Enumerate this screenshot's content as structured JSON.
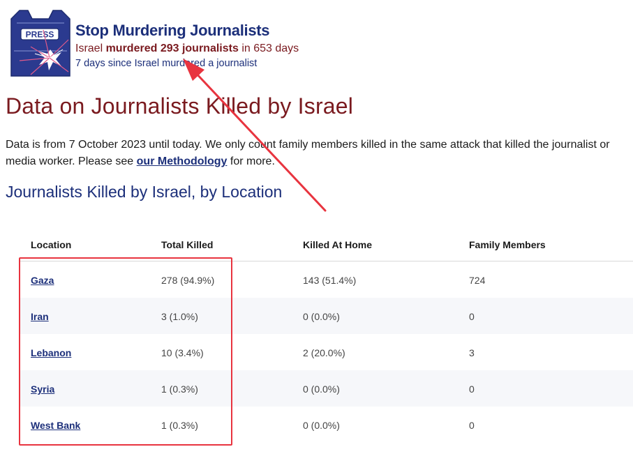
{
  "header": {
    "logo_text": "PRESS",
    "title": "Stop Murdering Journalists",
    "subtitle_prefix": "Israel ",
    "subtitle_bold": "murdered 293 journalists",
    "subtitle_suffix": " in 653 days",
    "days_since": "7 days since Israel murdered a journalist"
  },
  "main": {
    "title": "Data on Journalists Killed by Israel",
    "intro_before_link": "Data is from 7 October 2023 until today. We only count family members killed in the same attack that killed the journalist or media worker. Please see ",
    "intro_link": "our Methodology",
    "intro_after_link": " for more.",
    "section_title": "Journalists Killed by Israel, by Location"
  },
  "table": {
    "headers": [
      "Location",
      "Total Killed",
      "Killed At Home",
      "Family Members"
    ],
    "rows": [
      {
        "location": "Gaza",
        "total": "278 (94.9%)",
        "home": "143 (51.4%)",
        "family": "724"
      },
      {
        "location": "Iran",
        "total": "3 (1.0%)",
        "home": "0 (0.0%)",
        "family": "0"
      },
      {
        "location": "Lebanon",
        "total": "10 (3.4%)",
        "home": "2 (20.0%)",
        "family": "3"
      },
      {
        "location": "Syria",
        "total": "1 (0.3%)",
        "home": "0 (0.0%)",
        "family": "0"
      },
      {
        "location": "West Bank",
        "total": "1 (0.3%)",
        "home": "0 (0.0%)",
        "family": "0"
      }
    ]
  },
  "colors": {
    "brand_navy": "#1c2f7a",
    "brand_maroon": "#7a1a1f",
    "annotation_red": "#e8343f"
  }
}
